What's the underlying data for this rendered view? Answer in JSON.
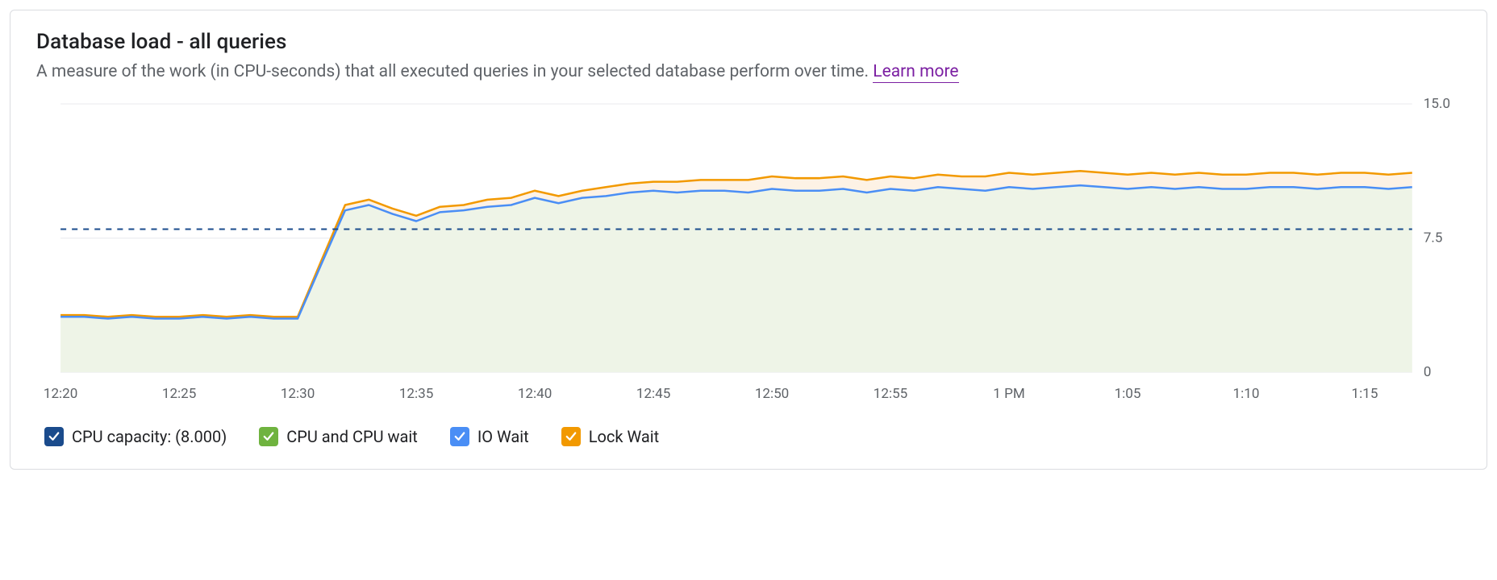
{
  "title": "Database load - all queries",
  "subtitle_text": "A measure of the work (in CPU-seconds) that all executed queries in your selected database perform over time. ",
  "learn_more": "Learn more",
  "legend": {
    "cpu_capacity": "CPU capacity: (8.000)",
    "cpu_wait": "CPU and CPU wait",
    "io_wait": "IO Wait",
    "lock_wait": "Lock Wait"
  },
  "chart_data": {
    "type": "area",
    "xlabel": "",
    "ylabel": "",
    "ylim": [
      0,
      15
    ],
    "y_ticks": [
      0,
      7.5,
      15.0
    ],
    "x_ticks": [
      "12:20",
      "12:25",
      "12:30",
      "12:35",
      "12:40",
      "12:45",
      "12:50",
      "12:55",
      "1 PM",
      "1:05",
      "1:10",
      "1:15"
    ],
    "reference_line": {
      "name": "CPU capacity",
      "value": 8.0
    },
    "x": [
      "12:20",
      "12:21",
      "12:22",
      "12:23",
      "12:24",
      "12:25",
      "12:26",
      "12:27",
      "12:28",
      "12:29",
      "12:30",
      "12:31",
      "12:32",
      "12:33",
      "12:34",
      "12:35",
      "12:36",
      "12:37",
      "12:38",
      "12:39",
      "12:40",
      "12:41",
      "12:42",
      "12:43",
      "12:44",
      "12:45",
      "12:46",
      "12:47",
      "12:48",
      "12:49",
      "12:50",
      "12:51",
      "12:52",
      "12:53",
      "12:54",
      "12:55",
      "12:56",
      "12:57",
      "12:58",
      "12:59",
      "13:00",
      "13:01",
      "13:02",
      "13:03",
      "13:04",
      "13:05",
      "13:06",
      "13:07",
      "13:08",
      "13:09",
      "13:10",
      "13:11",
      "13:12",
      "13:13",
      "13:14",
      "13:15",
      "13:16",
      "13:17"
    ],
    "series": [
      {
        "name": "CPU and CPU wait",
        "color": "#6fb33f",
        "fill": "#eef4e7",
        "values": [
          3.1,
          3.1,
          3.0,
          3.1,
          3.0,
          3.0,
          3.1,
          3.0,
          3.1,
          3.0,
          3.0,
          6.0,
          9.0,
          9.3,
          8.8,
          8.4,
          8.9,
          9.0,
          9.2,
          9.3,
          9.7,
          9.4,
          9.7,
          9.8,
          10.0,
          10.1,
          10.0,
          10.1,
          10.1,
          10.0,
          10.2,
          10.1,
          10.1,
          10.2,
          10.0,
          10.2,
          10.1,
          10.3,
          10.2,
          10.1,
          10.3,
          10.2,
          10.3,
          10.4,
          10.3,
          10.2,
          10.3,
          10.2,
          10.3,
          10.2,
          10.2,
          10.3,
          10.3,
          10.2,
          10.3,
          10.3,
          10.2,
          10.3
        ]
      },
      {
        "name": "IO Wait",
        "color": "#4a8ef5",
        "values": [
          0,
          0,
          0,
          0,
          0,
          0,
          0,
          0,
          0,
          0,
          0,
          0.05,
          0.05,
          0.05,
          0.05,
          0.05,
          0.05,
          0.05,
          0.05,
          0.05,
          0.05,
          0.05,
          0.05,
          0.05,
          0.05,
          0.05,
          0.05,
          0.05,
          0.05,
          0.05,
          0.05,
          0.05,
          0.05,
          0.05,
          0.05,
          0.05,
          0.05,
          0.05,
          0.05,
          0.05,
          0.05,
          0.05,
          0.05,
          0.05,
          0.05,
          0.05,
          0.05,
          0.05,
          0.05,
          0.05,
          0.05,
          0.05,
          0.05,
          0.05,
          0.05,
          0.05,
          0.05,
          0.05
        ]
      },
      {
        "name": "Lock Wait",
        "color": "#f29900",
        "fill": "#fdf2e5",
        "values": [
          0.1,
          0.1,
          0.1,
          0.1,
          0.1,
          0.1,
          0.1,
          0.1,
          0.1,
          0.1,
          0.1,
          0.2,
          0.3,
          0.3,
          0.3,
          0.3,
          0.3,
          0.3,
          0.4,
          0.4,
          0.4,
          0.4,
          0.4,
          0.5,
          0.5,
          0.5,
          0.6,
          0.6,
          0.6,
          0.7,
          0.7,
          0.7,
          0.7,
          0.7,
          0.7,
          0.7,
          0.7,
          0.7,
          0.7,
          0.8,
          0.8,
          0.8,
          0.8,
          0.8,
          0.8,
          0.8,
          0.8,
          0.8,
          0.8,
          0.8,
          0.8,
          0.8,
          0.8,
          0.8,
          0.8,
          0.8,
          0.8,
          0.8
        ]
      }
    ]
  }
}
